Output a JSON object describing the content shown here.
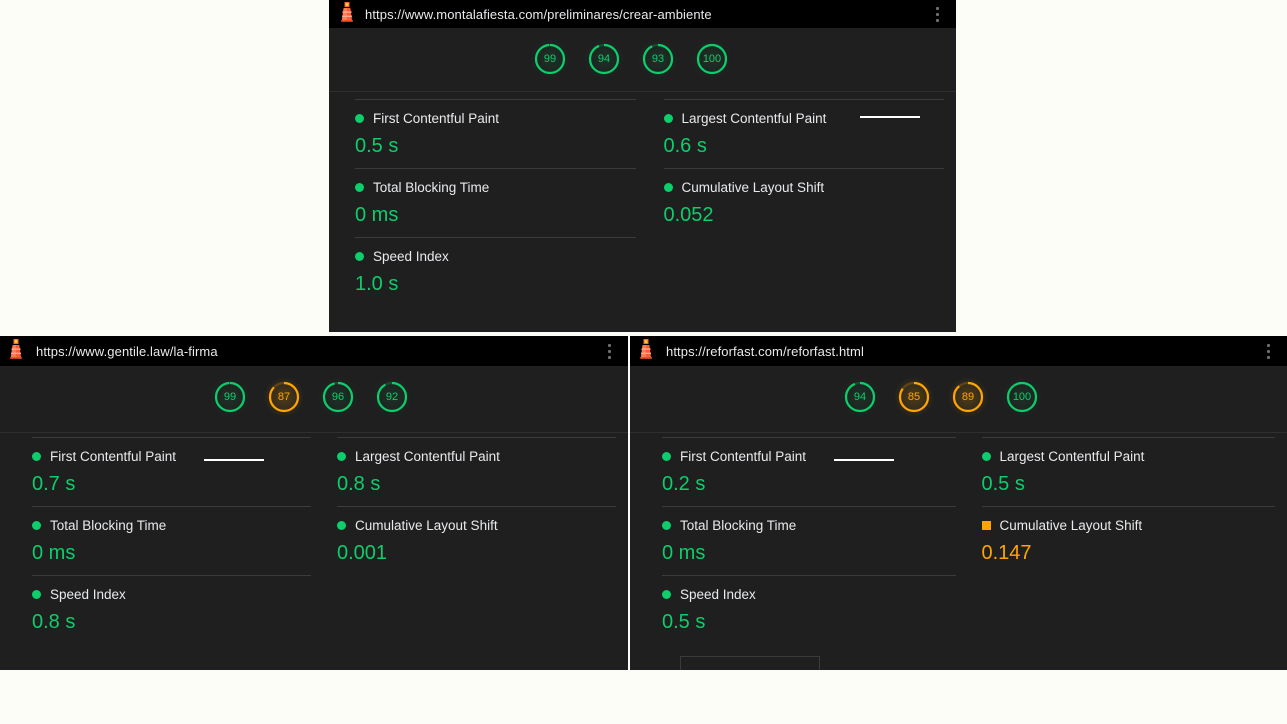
{
  "background_color": "#fdfdf8",
  "panel_bg": "#1f1f1f",
  "header_bg": "#000000",
  "colors": {
    "pass": "#0cce6b",
    "average": "#ffa400",
    "text": "#e8eaed",
    "tab_indicator": "#ffffff"
  },
  "icons": {
    "lighthouse": "lighthouse-icon",
    "menu": "kebab-menu-icon"
  },
  "panels": [
    {
      "id": "panel-top",
      "url": "https://www.montalafiesta.com/preliminares/crear-ambiente",
      "gauges": [
        {
          "score": "99",
          "status": "pass",
          "selected": true
        },
        {
          "score": "94",
          "status": "pass",
          "selected": false
        },
        {
          "score": "93",
          "status": "pass",
          "selected": false
        },
        {
          "score": "100",
          "status": "pass",
          "selected": false
        }
      ],
      "metrics": [
        {
          "label": "First Contentful Paint",
          "value": "0.5 s",
          "status": "pass",
          "marker": "dot"
        },
        {
          "label": "Largest Contentful Paint",
          "value": "0.6 s",
          "status": "pass",
          "marker": "dot"
        },
        {
          "label": "Total Blocking Time",
          "value": "0 ms",
          "status": "pass",
          "marker": "dot"
        },
        {
          "label": "Cumulative Layout Shift",
          "value": "0.052",
          "status": "pass",
          "marker": "dot"
        },
        {
          "label": "Speed Index",
          "value": "1.0 s",
          "status": "pass",
          "marker": "dot"
        }
      ]
    },
    {
      "id": "panel-left",
      "url": "https://www.gentile.law/la-firma",
      "gauges": [
        {
          "score": "99",
          "status": "pass",
          "selected": true
        },
        {
          "score": "87",
          "status": "average",
          "selected": false
        },
        {
          "score": "96",
          "status": "pass",
          "selected": false
        },
        {
          "score": "92",
          "status": "pass",
          "selected": false
        }
      ],
      "metrics": [
        {
          "label": "First Contentful Paint",
          "value": "0.7 s",
          "status": "pass",
          "marker": "dot"
        },
        {
          "label": "Largest Contentful Paint",
          "value": "0.8 s",
          "status": "pass",
          "marker": "dot"
        },
        {
          "label": "Total Blocking Time",
          "value": "0 ms",
          "status": "pass",
          "marker": "dot"
        },
        {
          "label": "Cumulative Layout Shift",
          "value": "0.001",
          "status": "pass",
          "marker": "dot"
        },
        {
          "label": "Speed Index",
          "value": "0.8 s",
          "status": "pass",
          "marker": "dot"
        }
      ]
    },
    {
      "id": "panel-right",
      "url": "https://reforfast.com/reforfast.html",
      "gauges": [
        {
          "score": "94",
          "status": "pass",
          "selected": true
        },
        {
          "score": "85",
          "status": "average",
          "selected": false
        },
        {
          "score": "89",
          "status": "average",
          "selected": false
        },
        {
          "score": "100",
          "status": "pass",
          "selected": false
        }
      ],
      "metrics": [
        {
          "label": "First Contentful Paint",
          "value": "0.2 s",
          "status": "pass",
          "marker": "dot"
        },
        {
          "label": "Largest Contentful Paint",
          "value": "0.5 s",
          "status": "pass",
          "marker": "dot"
        },
        {
          "label": "Total Blocking Time",
          "value": "0 ms",
          "status": "pass",
          "marker": "dot"
        },
        {
          "label": "Cumulative Layout Shift",
          "value": "0.147",
          "status": "average",
          "marker": "square"
        },
        {
          "label": "Speed Index",
          "value": "0.5 s",
          "status": "pass",
          "marker": "dot"
        }
      ]
    }
  ]
}
